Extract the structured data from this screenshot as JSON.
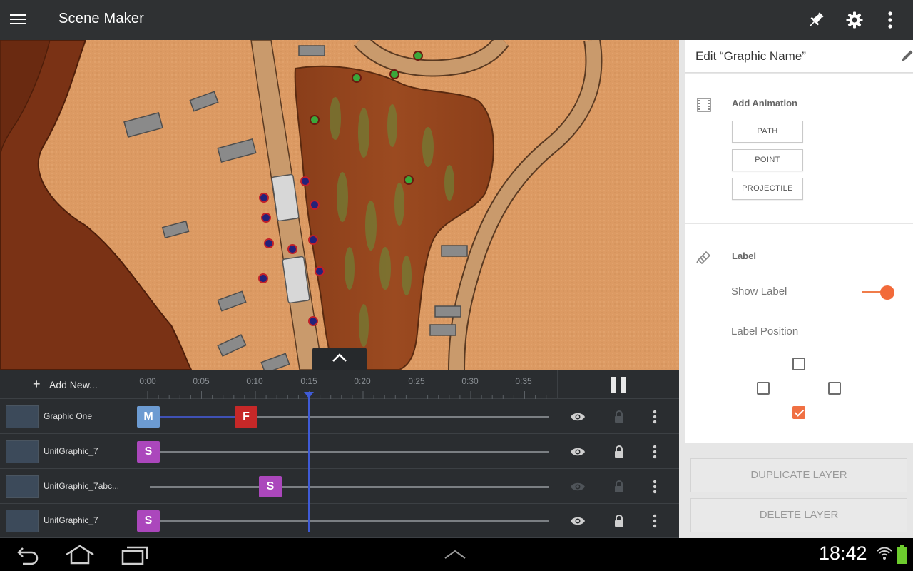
{
  "appbar": {
    "title": "Scene Maker",
    "icons": [
      "menu-icon",
      "pin-icon",
      "settings-icon",
      "more-vert-icon"
    ]
  },
  "map": {
    "description_icons": [
      "map-tile"
    ],
    "collapse_icon": "chevron-up-icon"
  },
  "timeline": {
    "add_new_label": "Add New...",
    "ticks": [
      "0:00",
      "0:05",
      "0:10",
      "0:15",
      "0:20",
      "0:25",
      "0:30",
      "0:35"
    ],
    "playhead_time": "0:15",
    "layers": [
      {
        "name": "Graphic One",
        "visible": true,
        "locked": false,
        "keys": [
          {
            "letter": "M",
            "color": "#6c9bd2"
          },
          {
            "letter": "F",
            "color": "#c62828"
          }
        ]
      },
      {
        "name": "UnitGraphic_7",
        "visible": true,
        "locked": true,
        "keys": [
          {
            "letter": "S",
            "color": "#ab47bc"
          }
        ]
      },
      {
        "name": "UnitGraphic_7abc...",
        "visible": false,
        "locked": false,
        "keys": [
          {
            "letter": "S",
            "color": "#ab47bc"
          }
        ]
      },
      {
        "name": "UnitGraphic_7",
        "visible": true,
        "locked": true,
        "keys": [
          {
            "letter": "S",
            "color": "#ab47bc"
          }
        ]
      }
    ]
  },
  "panel": {
    "edit_title": "Edit “Graphic Name”",
    "add_animation": {
      "title": "Add Animation",
      "buttons": [
        "PATH",
        "POINT",
        "PROJECTILE"
      ]
    },
    "label_section": {
      "title": "Label",
      "show_label": "Show Label",
      "show_label_on": true,
      "label_position": "Label Position",
      "positions": {
        "top": false,
        "left": false,
        "right": false,
        "bottom": true
      }
    },
    "duplicate_label": "DUPLICATE LAYER",
    "delete_label": "DELETE LAYER",
    "accent_color": "#f26a3a"
  },
  "systembar": {
    "time": "18:42",
    "icons": [
      "back-icon",
      "home-icon",
      "recents-icon",
      "chevron-up-icon",
      "wifi-icon",
      "battery-icon"
    ]
  }
}
